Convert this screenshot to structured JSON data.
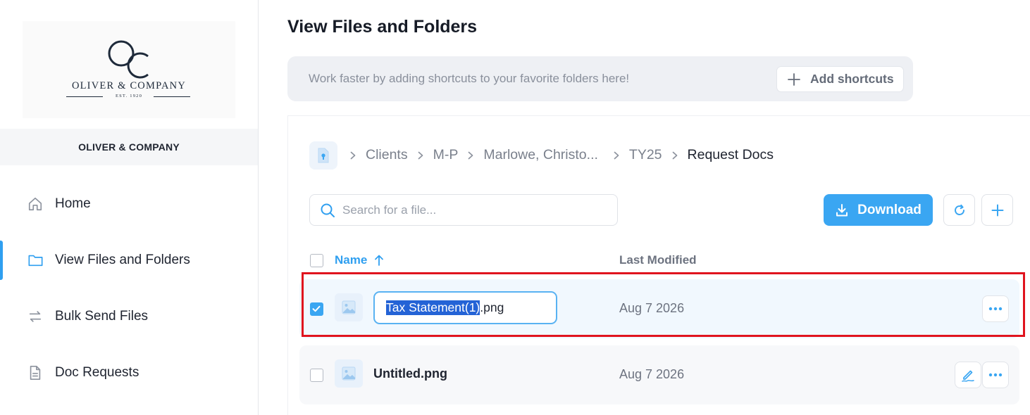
{
  "brand": {
    "logo_monogram": "OC",
    "logo_name": "OLIVER & COMPANY",
    "logo_est": "EST. 1920",
    "org_name": "OLIVER & COMPANY"
  },
  "sidebar": {
    "items": [
      {
        "label": "Home",
        "icon": "home-icon",
        "active": false
      },
      {
        "label": "View Files and Folders",
        "icon": "folder-icon",
        "active": true
      },
      {
        "label": "Bulk Send Files",
        "icon": "swap-arrows-icon",
        "active": false
      },
      {
        "label": "Doc Requests",
        "icon": "document-icon",
        "active": false
      }
    ]
  },
  "main": {
    "title": "View Files and Folders",
    "shortcuts": {
      "hint": "Work faster by adding shortcuts to your favorite folders here!",
      "button_label": "Add shortcuts"
    },
    "breadcrumb": [
      "Clients",
      "M-P",
      "Marlowe, Christo...",
      "TY25",
      "Request Docs"
    ],
    "search": {
      "placeholder": "Search for a file...",
      "value": ""
    },
    "download_label": "Download",
    "columns": {
      "name": "Name",
      "last_modified": "Last Modified"
    },
    "files": [
      {
        "name": "Tax Statement(1).png",
        "rename_selected": "Tax Statement(1)",
        "rename_rest": ".png",
        "modified": "Aug 7 2026",
        "checked": true,
        "renaming": true
      },
      {
        "name": "Untitled.png",
        "modified": "Aug 7 2026",
        "checked": false,
        "renaming": false
      }
    ]
  },
  "colors": {
    "accent": "#3aa6f2",
    "highlight_outline": "#e0141e",
    "text_selection": "#2463d6"
  }
}
